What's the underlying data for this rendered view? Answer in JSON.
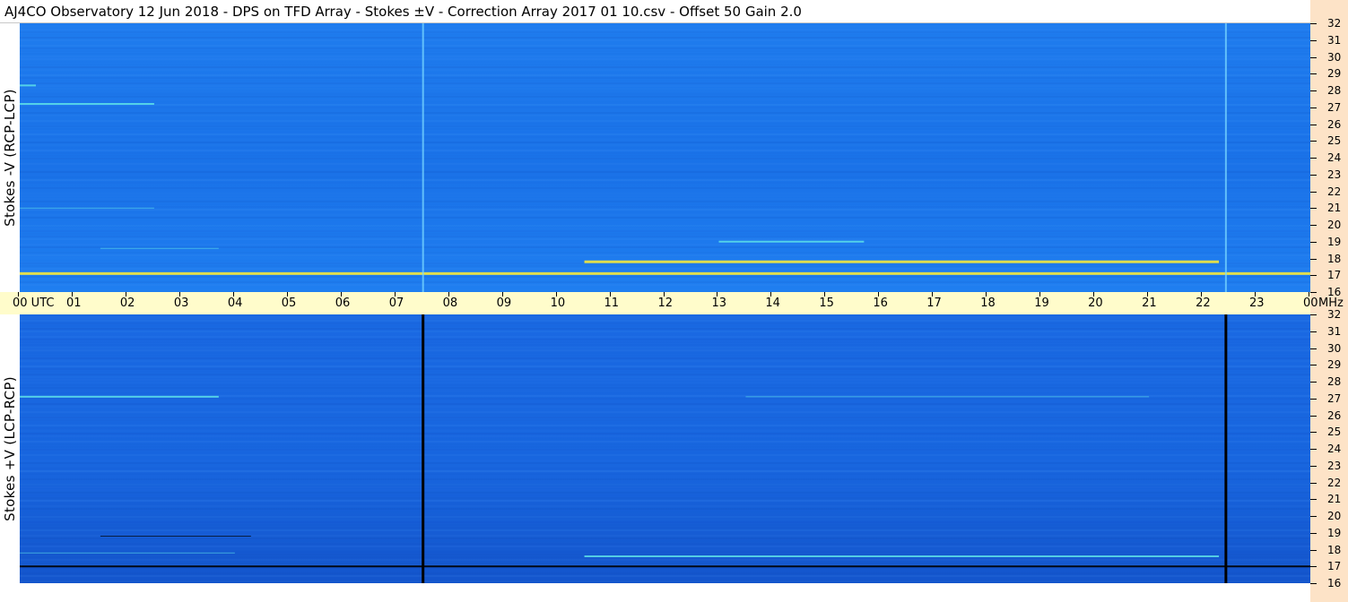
{
  "title": "AJ4CO Observatory  12 Jun 2018  -  DPS on TFD Array  -  Stokes ±V  -  Correction Array 2017 01 10.csv  -  Offset 50  Gain 2.0",
  "colors": {
    "background": "#ffffff",
    "axis_bar": "#fffccb",
    "right_strip": "#fde3c7",
    "spectrogram_base_top": "#1a72e8",
    "spectrogram_base_bottom": "#1866df",
    "emission_yellow": "#f5e83c",
    "emission_cyan": "#5de0e8",
    "absorption_dark": "#000000"
  },
  "chart_data": [
    {
      "type": "heatmap",
      "title": "AJ4CO Observatory  12 Jun 2018  -  DPS on TFD Array  -  Stokes ±V  -  Correction Array 2017 01 10.csv  -  Offset 50  Gain 2.0",
      "ylabel": "Stokes -V (RCP-LCP)",
      "x_units": "UTC",
      "x_range": [
        0,
        24
      ],
      "x_tick_labels": [
        "00 UTC",
        "01",
        "02",
        "03",
        "04",
        "05",
        "06",
        "07",
        "08",
        "09",
        "10",
        "11",
        "12",
        "13",
        "14",
        "15",
        "16",
        "17",
        "18",
        "19",
        "20",
        "21",
        "22",
        "23",
        "00"
      ],
      "y_units": "MHz",
      "y_range": [
        16,
        32
      ],
      "y_tick_labels": [
        "16",
        "17",
        "18",
        "19",
        "20",
        "21",
        "22",
        "23",
        "24",
        "25",
        "26",
        "27",
        "28",
        "29",
        "30",
        "31",
        "32"
      ],
      "vertical_lines_utc": [
        7.5,
        22.43
      ],
      "features": [
        {
          "freq_mhz": 17.1,
          "utc_start": 0.0,
          "utc_end": 24.0,
          "strength": "strong"
        },
        {
          "freq_mhz": 17.8,
          "utc_start": 10.5,
          "utc_end": 22.3,
          "strength": "strong"
        },
        {
          "freq_mhz": 19.0,
          "utc_start": 13.0,
          "utc_end": 15.7,
          "strength": "medium"
        },
        {
          "freq_mhz": 27.2,
          "utc_start": 0.0,
          "utc_end": 2.5,
          "strength": "medium"
        },
        {
          "freq_mhz": 28.3,
          "utc_start": 0.0,
          "utc_end": 0.3,
          "strength": "medium"
        },
        {
          "freq_mhz": 21.0,
          "utc_start": 0.0,
          "utc_end": 2.5,
          "strength": "weak"
        },
        {
          "freq_mhz": 18.6,
          "utc_start": 1.5,
          "utc_end": 3.7,
          "strength": "weak"
        }
      ]
    },
    {
      "type": "heatmap",
      "ylabel": "Stokes +V (LCP-RCP)",
      "x_units": "UTC",
      "x_range": [
        0,
        24
      ],
      "y_units": "MHz",
      "y_range": [
        16,
        32
      ],
      "y_tick_labels": [
        "16",
        "17",
        "18",
        "19",
        "20",
        "21",
        "22",
        "23",
        "24",
        "25",
        "26",
        "27",
        "28",
        "29",
        "30",
        "31",
        "32"
      ],
      "vertical_lines_utc": [
        7.5,
        22.43
      ],
      "features": [
        {
          "freq_mhz": 17.0,
          "utc_start": 0.0,
          "utc_end": 24.0,
          "strength": "absorption"
        },
        {
          "freq_mhz": 17.6,
          "utc_start": 10.5,
          "utc_end": 22.3,
          "strength": "medium"
        },
        {
          "freq_mhz": 27.1,
          "utc_start": 0.0,
          "utc_end": 3.7,
          "strength": "medium"
        },
        {
          "freq_mhz": 27.1,
          "utc_start": 13.5,
          "utc_end": 21.0,
          "strength": "weak"
        },
        {
          "freq_mhz": 17.8,
          "utc_start": 0.0,
          "utc_end": 4.0,
          "strength": "weak"
        },
        {
          "freq_mhz": 18.8,
          "utc_start": 1.5,
          "utc_end": 4.3,
          "strength": "absorption-weak"
        }
      ]
    }
  ]
}
